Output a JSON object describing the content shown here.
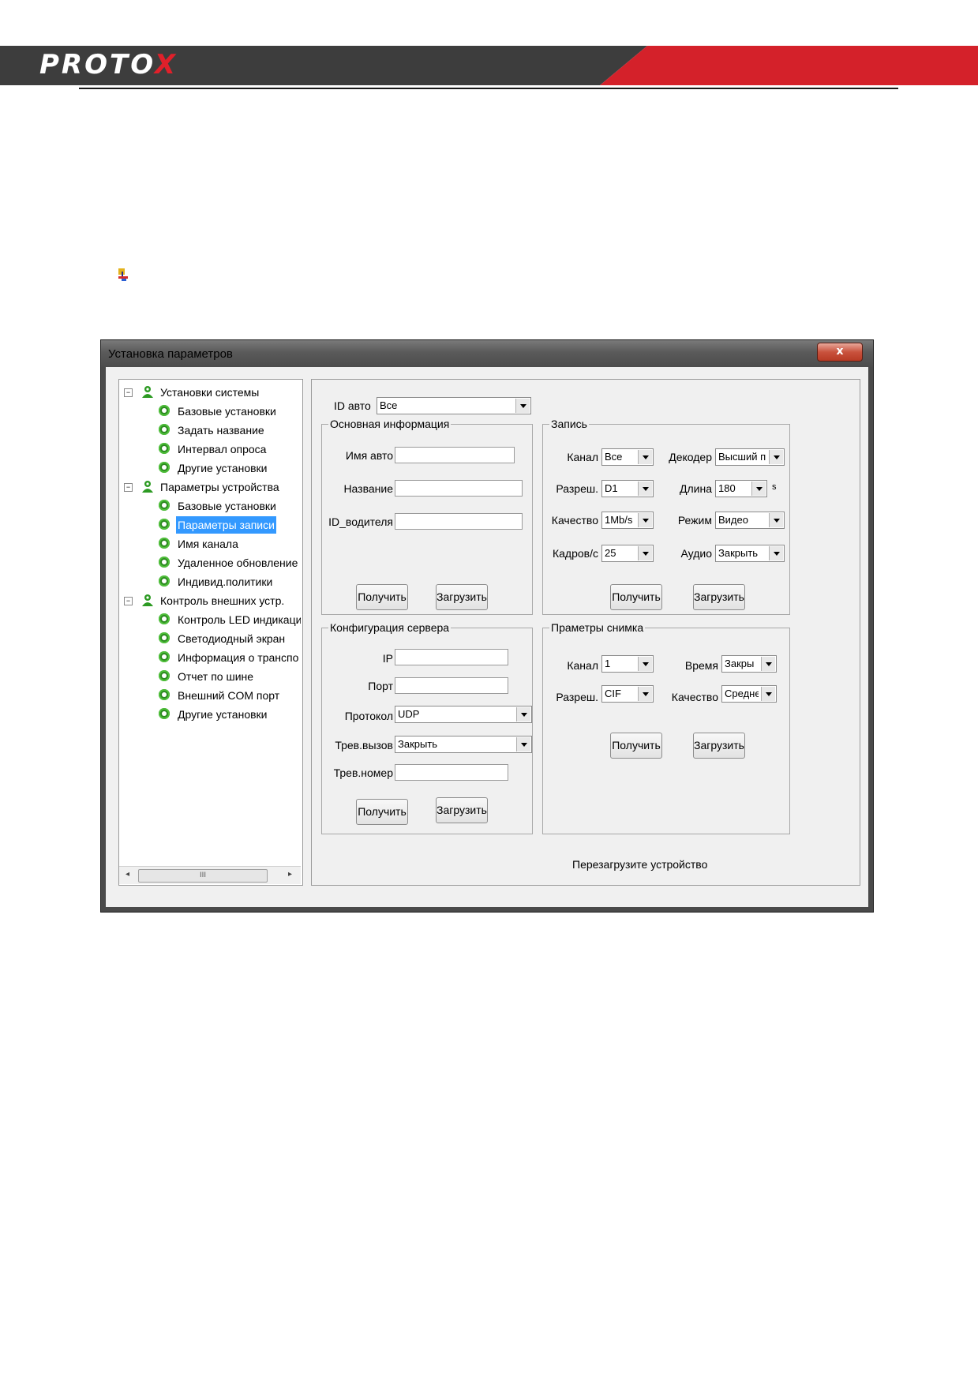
{
  "logo": {
    "text": "PROTO",
    "accent": "X"
  },
  "colors": {
    "banner_dark": "#3d3d3d",
    "banner_red": "#d4212a",
    "selection": "#3399ff"
  },
  "window": {
    "title": "Установка параметров",
    "close_glyph": "x"
  },
  "tree": {
    "groups": [
      {
        "label": "Установки системы",
        "items": [
          "Базовые установки",
          "Задать название",
          "Интервал опроса",
          "Другие установки"
        ]
      },
      {
        "label": "Параметры устройства",
        "items": [
          "Базовые установки",
          "Параметры записи",
          "Имя канала",
          "Удаленное обновление",
          "Индивид.политики"
        ]
      },
      {
        "label": "Контроль внешних устр.",
        "items": [
          "Контроль LED индикаци",
          "Светодиодный экран",
          "Информация о транспо",
          "Отчет по шине",
          "Внешний COM порт",
          "Другие установки"
        ]
      }
    ],
    "selected": "Параметры записи",
    "scroll_thumb": "III"
  },
  "id_auto": {
    "label": "ID авто",
    "value": "Все"
  },
  "basic_info": {
    "title": "Основная информация",
    "car_name_label": "Имя авто",
    "name_label": "Название",
    "driver_label": "ID_водителя",
    "get_label": "Получить",
    "load_label": "Загрузить"
  },
  "record": {
    "title": "Запись",
    "channel_label": "Канал",
    "channel_value": "Все",
    "decoder_label": "Декодер",
    "decoder_value": "Высший пр",
    "resolution_label": "Разреш.",
    "resolution_value": "D1",
    "length_label": "Длина",
    "length_value": "180",
    "length_unit": "s",
    "quality_label": "Качество",
    "quality_value": "1Mb/s",
    "mode_label": "Режим",
    "mode_value": "Видео",
    "fps_label": "Кадров/с",
    "fps_value": "25",
    "audio_label": "Аудио",
    "audio_value": "Закрыть",
    "get_label": "Получить",
    "load_label": "Загрузить"
  },
  "server": {
    "title": "Конфигурация сервера",
    "ip_label": "IP",
    "port_label": "Порт",
    "protocol_label": "Протокол",
    "protocol_value": "UDP",
    "alarm_call_label": "Трев.вызов",
    "alarm_call_value": "Закрыть",
    "alarm_number_label": "Трев.номер",
    "get_label": "Получить",
    "load_label": "Загрузить"
  },
  "snapshot": {
    "title": "Праметры снимка",
    "channel_label": "Канал",
    "channel_value": "1",
    "time_label": "Время",
    "time_value": "Закры",
    "resolution_label": "Разреш.",
    "resolution_value": "CIF",
    "quality_label": "Качество",
    "quality_value": "Средне",
    "get_label": "Получить",
    "load_label": "Загрузить"
  },
  "status_text": "Перезагрузите устройство"
}
